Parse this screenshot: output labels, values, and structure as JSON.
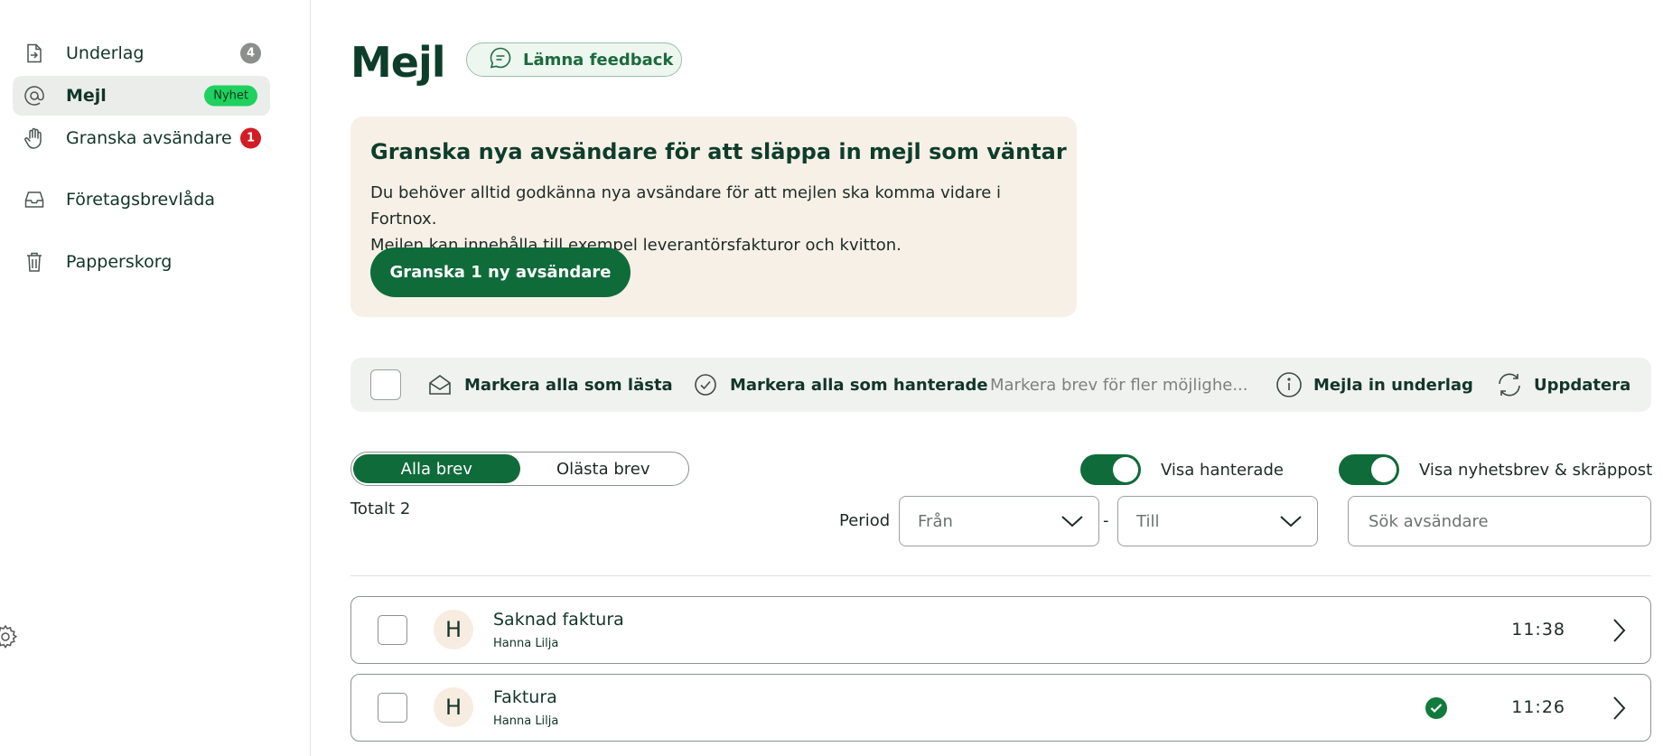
{
  "sidebar": {
    "items": [
      {
        "label": "Underlag",
        "icon": "document-arrow-icon",
        "badge": "4"
      },
      {
        "label": "Mejl",
        "icon": "at-sign-icon",
        "badge": "Nyhet"
      },
      {
        "label": "Granska avsändare",
        "icon": "hand-icon",
        "badge": "1"
      },
      {
        "label": "Företagsbrevlåda",
        "icon": "inbox-tray-icon"
      },
      {
        "label": "Papperskorg",
        "icon": "trash-icon"
      }
    ]
  },
  "header": {
    "title": "Mejl",
    "feedback_label": "Lämna feedback"
  },
  "banner": {
    "title": "Granska nya avsändare för att släppa in mejl som väntar",
    "text_line1": "Du behöver alltid godkänna nya avsändare för att mejlen ska komma vidare i Fortnox.",
    "text_line2": "Mejlen kan innehålla till exempel leverantörsfakturor och kvitton.",
    "button_label": "Granska 1 ny avsändare"
  },
  "toolbar": {
    "mark_read_label": "Markera alla som lästa",
    "mark_handled_label": "Markera alla som hanterade",
    "hint": "Markera brev för fler möjlighe...",
    "mail_in_label": "Mejla in underlag",
    "refresh_label": "Uppdatera"
  },
  "filters": {
    "segments": [
      "Alla brev",
      "Olästa brev"
    ],
    "active_segment": "Alla brev",
    "toggle_handled_label": "Visa hanterade",
    "toggle_handled_on": true,
    "toggle_newsletters_label": "Visa nyhetsbrev & skräppost",
    "toggle_newsletters_on": true,
    "total": "Totalt 2",
    "period_label": "Period",
    "from_placeholder": "Från",
    "separator": "-",
    "to_placeholder": "Till",
    "search_placeholder": "Sök avsändare"
  },
  "emails": [
    {
      "avatar": "H",
      "subject": "Saknad faktura",
      "sender": "Hanna Lilja",
      "time": "11:38",
      "handled": false
    },
    {
      "avatar": "H",
      "subject": "Faktura",
      "sender": "Hanna Lilja",
      "time": "11:26",
      "handled": true
    }
  ],
  "colors": {
    "brand_green": "#0f6b3a",
    "banner_bg": "#f7f0e7",
    "new_badge": "#1fd15e",
    "alert_red": "#d31d24"
  }
}
